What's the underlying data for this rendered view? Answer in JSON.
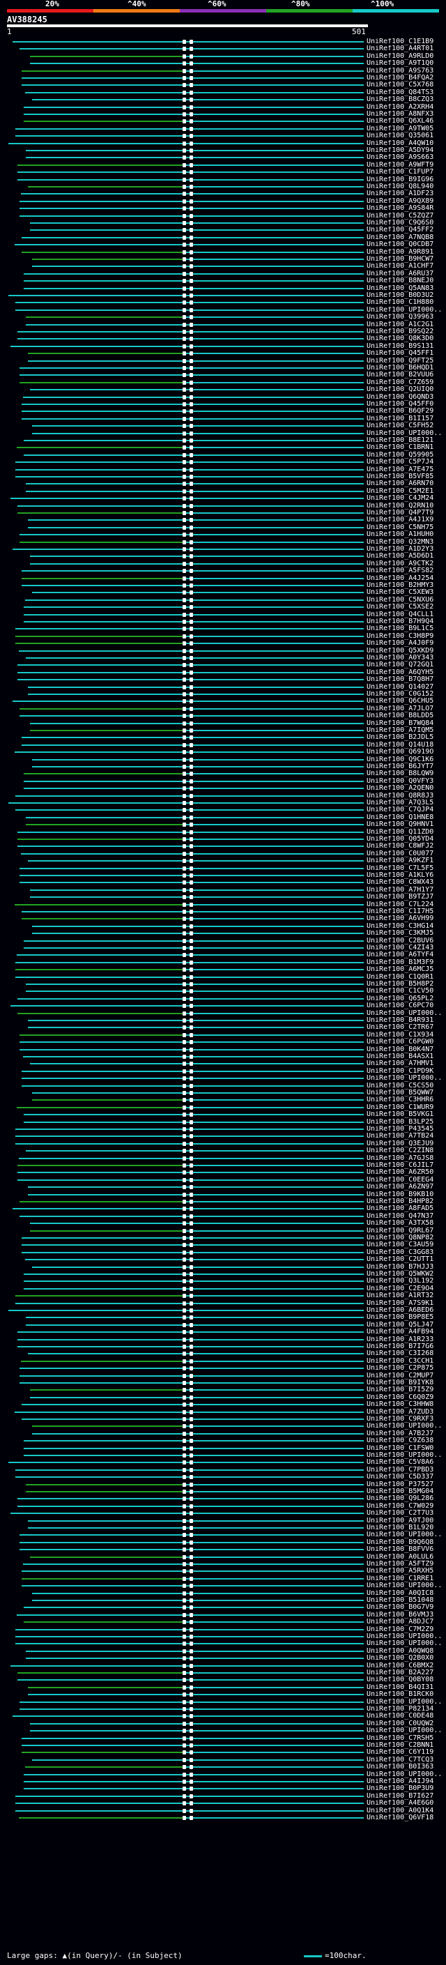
{
  "identity_scale": {
    "labels": [
      "20%",
      "^40%",
      "^60%",
      "^80%",
      "^100%"
    ],
    "colors": [
      "#e41a1c",
      "#ee7a14",
      "#8a2fb6",
      "#22a322",
      "#17c8c8"
    ]
  },
  "query": {
    "id": "AV388245",
    "start": "1",
    "end": "501"
  },
  "hits": [
    "UniRef100_C1E1B9",
    "UniRef100_A4RT01",
    "UniRef100_A9RLD0",
    "UniRef100_A9T1Q0",
    "UniRef100_A9S763",
    "UniRef100_B4FQA2",
    "UniRef100_C5X768",
    "UniRef100_Q84TS3",
    "UniRef100_B8CZQ3",
    "UniRef100_A2XRH4",
    "UniRef100_A8NFX3",
    "UniRef100_Q6XL46",
    "UniRef100_A9TW05",
    "UniRef100_Q35061",
    "UniRef100_A4QW10",
    "UniRef100_A5DY94",
    "UniRef100_A9S663",
    "UniRef100_A9WFT9",
    "UniRef100_C1FUP7",
    "UniRef100_B9IG96",
    "UniRef100_Q8L940",
    "UniRef100_A1DF23",
    "UniRef100_A9QX89",
    "UniRef100_A9S84R",
    "UniRef100_C5ZQZ7",
    "UniRef100_C9Q6S0",
    "UniRef100_Q45FF2",
    "UniRef100_A7NQB8",
    "UniRef100_Q0CDB7",
    "UniRef100_A9R891",
    "UniRef100_B9HCW7",
    "UniRef100_A1CHF7",
    "UniRef100_A6RU37",
    "UniRef100_B8NEJ0",
    "UniRef100_Q5AN83",
    "UniRef100_B0D3U2",
    "UniRef100_C1H880",
    "UniRef100_UPI000...",
    "UniRef100_Q39963",
    "UniRef100_A1C2G1",
    "UniRef100_B9SQ22",
    "UniRef100_Q8K3D0",
    "UniRef100_B9S131",
    "UniRef100_Q45FF1",
    "UniRef100_Q9FT25",
    "UniRef100_B6HQD1",
    "UniRef100_B2VUU6",
    "UniRef100_C7Z659",
    "UniRef100_Q2UIQ0",
    "UniRef100_Q6QND3",
    "UniRef100_Q45FF0",
    "UniRef100_B6QF29",
    "UniRef100_B1I157",
    "UniRef100_C5FH52",
    "UniRef100_UPI000...",
    "UniRef100_B8E121",
    "UniRef100_C1BRN1",
    "UniRef100_Q59905",
    "UniRef100_C5P7J4",
    "UniRef100_A7E475",
    "UniRef100_B5VF85",
    "UniRef100_A6RN70",
    "UniRef100_C5M2E1",
    "UniRef100_C4JM24",
    "UniRef100_Q2RN10",
    "UniRef100_Q4P7T9",
    "UniRef100_A4J1X9",
    "UniRef100_C5NH75",
    "UniRef100_A1HUH0",
    "UniRef100_Q32MN3",
    "UniRef100_A1D2Y3",
    "UniRef100_A5D6D1",
    "UniRef100_A9CTK2",
    "UniRef100_A5FS82",
    "UniRef100_A4J254",
    "UniRef100_B2HMY3",
    "UniRef100_C5XEW3",
    "UniRef100_C5NXU6",
    "UniRef100_C5XSE2",
    "UniRef100_Q4CLL1",
    "UniRef100_B7H9Q4",
    "UniRef100_B9L1C5",
    "UniRef100_C3H8P9",
    "UniRef100_A4J0F9",
    "UniRef100_Q5XKD9",
    "UniRef100_A0Y343",
    "UniRef100_Q72GQ1",
    "UniRef100_A6QYH5",
    "UniRef100_B7Q8H7",
    "UniRef100_Q14027",
    "UniRef100_C0G152",
    "UniRef100_Q6CHU5",
    "UniRef100_A7JLO7",
    "UniRef100_B8LDD5",
    "UniRef100_B7WQ84",
    "UniRef100_A7IQM5",
    "UniRef100_B2JDL5",
    "UniRef100_Q14U18",
    "UniRef100_Q6919O",
    "UniRef100_Q9C1K6",
    "UniRef100_B6JYT7",
    "UniRef100_B8LQW9",
    "UniRef100_Q0VFY3",
    "UniRef100_A2QEN0",
    "UniRef100_Q8R8J3",
    "UniRef100_A7Q3L5",
    "UniRef100_C7QJP4",
    "UniRef100_Q1HNE8",
    "UniRef100_Q9HNV1",
    "UniRef100_Q11ZD0",
    "UniRef100_Q05YD4",
    "UniRef100_C8WFJ2",
    "UniRef100_C0U077",
    "UniRef100_A9KZF1",
    "UniRef100_C7L5F5",
    "UniRef100_A1KLY6",
    "UniRef100_C8WX43",
    "UniRef100_A7H1Y7",
    "UniRef100_B9TZJ7",
    "UniRef100_C7L224",
    "UniRef100_C1I7H5",
    "UniRef100_A6VH99",
    "UniRef100_C3HG14",
    "UniRef100_C3KMJ5",
    "UniRef100_C2BUV6",
    "UniRef100_C4ZI43",
    "UniRef100_A6TYF4",
    "UniRef100_B1M3F9",
    "UniRef100_A6MCJ5",
    "UniRef100_C1Q0R1",
    "UniRef100_B5H8P2",
    "UniRef100_C1CV50",
    "UniRef100_Q65PL2",
    "UniRef100_C6PC70",
    "UniRef100_UPI000...",
    "UniRef100_B4R931",
    "UniRef100_C2TR67",
    "UniRef100_C1X934",
    "UniRef100_C6PGW0",
    "UniRef100_B0K4N7",
    "UniRef100_B4ASX1",
    "UniRef100_A7HMV1",
    "UniRef100_C1PD9K",
    "UniRef100_UPI000...",
    "UniRef100_C5CS50",
    "UniRef100_B5QWW7",
    "UniRef100_C3HHR6",
    "UniRef100_C1WUR9",
    "UniRef100_B5VKG1",
    "UniRef100_B3LP25",
    "UniRef100_P43545",
    "UniRef100_A7TB24",
    "UniRef100_Q3EJU9",
    "UniRef100_C2ZIN8",
    "UniRef100_A7GJS8",
    "UniRef100_C6JIL7",
    "UniRef100_A6ZR50",
    "UniRef100_C0EEG4",
    "UniRef100_A6ZN97",
    "UniRef100_B9KB10",
    "UniRef100_B4HP82",
    "UniRef100_A8FAD5",
    "UniRef100_Q47N37",
    "UniRef100_A3TX58",
    "UniRef100_Q9RL67",
    "UniRef100_Q8NP82",
    "UniRef100_C3AU59",
    "UniRef100_C3GG83",
    "UniRef100_C2UTT1",
    "UniRef100_B7HJJ3",
    "UniRef100_Q5WKW2",
    "UniRef100_Q3L192",
    "UniRef100_C2E9O4",
    "UniRef100_A1RT32",
    "UniRef100_A7S9K1",
    "UniRef100_A6BED6",
    "UniRef100_B9P8E5",
    "UniRef100_Q5LJ47",
    "UniRef100_A4FB94",
    "UniRef100_A1R233",
    "UniRef100_B7I7G6",
    "UniRef100_C3I268",
    "UniRef100_C3CCH1",
    "UniRef100_C2P875",
    "UniRef100_C2MUP7",
    "UniRef100_B9IYK8",
    "UniRef100_B7I5Z9",
    "UniRef100_C6Q0Z9",
    "UniRef100_C3HHW8",
    "UniRef100_A7ZUD3",
    "UniRef100_C9RXF3",
    "UniRef100_UPI000...",
    "UniRef100_A7B2J7",
    "UniRef100_C9Z638",
    "UniRef100_C1FSW0",
    "UniRef100_UPI000...",
    "UniRef100_C5V8A6",
    "UniRef100_C7PBD3",
    "UniRef100_C5D337",
    "UniRef100_P37527",
    "UniRef100_B5MG04",
    "UniRef100_Q9L286",
    "UniRef100_C7W029",
    "UniRef100_C2T7U3",
    "UniRef100_A9TJ00",
    "UniRef100_B1L920",
    "UniRef100_UPI000...",
    "UniRef100_B9Q6Q8",
    "UniRef100_B8FVV6",
    "UniRef100_A0LUL6",
    "UniRef100_A5FTZ9",
    "UniRef100_A5RXH5",
    "UniRef100_C1RRE1",
    "UniRef100_UPI000...",
    "UniRef100_A0QIC8",
    "UniRef100_B51048",
    "UniRef100_B0G7V9",
    "UniRef100_B6VMJ3",
    "UniRef100_A8DJC7",
    "UniRef100_C7M2Z9",
    "UniRef100_UPI000...",
    "UniRef100_UPI000...",
    "UniRef100_A0QWQ8",
    "UniRef100_Q2B0X0",
    "UniRef100_C6BMX2",
    "UniRef100_B2A227",
    "UniRef100_Q0BY08",
    "UniRef100_B4QI31",
    "UniRef100_B1RCK0",
    "UniRef100_UPI000...",
    "UniRef100_P82134",
    "UniRef100_C0DE48",
    "UniRef100_C0UQW2",
    "UniRef100_UPI000...",
    "UniRef100_C7RSH5",
    "UniRef100_C2BNN1",
    "UniRef100_C6Y119",
    "UniRef100_C7TCQ3",
    "UniRef100_B0I363",
    "UniRef100_UPI000...",
    "UniRef100_A4IJ94",
    "UniRef100_B0P3U9",
    "UniRef100_B7I627",
    "UniRef100_A4E6G0",
    "UniRef100_A0Q1K4",
    "UniRef100_Q6VF18"
  ],
  "legend": {
    "gap_text": "Large gaps: ▲(in Query)/- (in Subject)",
    "scale_text": "=100char."
  }
}
